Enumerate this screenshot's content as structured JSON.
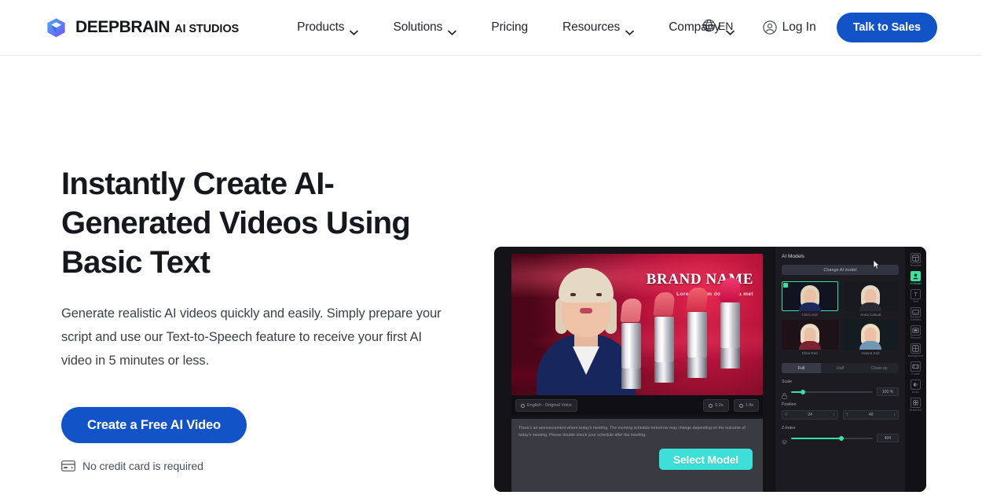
{
  "brand": {
    "name": "DEEPBRAIN",
    "subtitle": "AI STUDIOS",
    "logo_icon": "cube-logo-icon",
    "gradient_start": "#4ea8ff",
    "gradient_end": "#7a4df0"
  },
  "nav": {
    "items": [
      {
        "label": "Products",
        "has_dropdown": true,
        "icon": "chevron-down-icon"
      },
      {
        "label": "Solutions",
        "has_dropdown": true,
        "icon": "chevron-down-icon"
      },
      {
        "label": "Pricing",
        "has_dropdown": false,
        "icon": ""
      },
      {
        "label": "Resources",
        "has_dropdown": true,
        "icon": "chevron-down-icon"
      },
      {
        "label": "Company",
        "has_dropdown": true,
        "icon": "chevron-down-icon"
      }
    ]
  },
  "language": {
    "code": "EN",
    "icon": "globe-icon"
  },
  "account": {
    "login_label": "Log In",
    "login_icon": "user-circle-icon",
    "cta_label": "Talk to Sales",
    "cta_color": "#1254c8"
  },
  "hero": {
    "title": "Instantly Create AI-Generated Videos Using Basic Text",
    "subtitle": "Generate realistic AI videos quickly and easily. Simply prepare your script and use our Text-to-Speech feature to receive your first AI video in 5 minutes or less.",
    "cta_label": "Create a Free AI Video",
    "cta_color": "#1254c8",
    "note": "No credit card is required",
    "note_icon": "credit-card-icon"
  },
  "preview": {
    "stage": {
      "brand_name": "BRAND NAME",
      "brand_tagline": "Lorem ipsum dolor sit a met"
    },
    "player_bar": {
      "voice_label": "English - Original Voice",
      "voice_icon": "waveform-icon",
      "duration_label": "0.2s",
      "duration_icon": "clock-icon",
      "total_label": "1.4s",
      "total_icon": "clock-icon"
    },
    "script": "There's an announcement where today's meeting. The morning schedule tomorrow may change depending on the outcome of today's meeting. Please double-check your schedule after the meeting.",
    "select_model_label": "Select Model",
    "select_model_color": "#3ce0d8",
    "panel": {
      "title": "AI Models",
      "change_model_label": "Change AI model",
      "models": [
        {
          "label": "Clara Suit",
          "selected": true,
          "hair": "#ded3bc",
          "shoulder": "#1b2a5e"
        },
        {
          "label": "Anna Casual",
          "selected": false,
          "hair": "#e3d9c6",
          "shoulder": "#2a2a34"
        },
        {
          "label": "Elina Red",
          "selected": false,
          "hair": "#e8dcc5",
          "shoulder": "#7d2230"
        },
        {
          "label": "Hanna Knit",
          "selected": false,
          "hair": "#e9dcc0",
          "shoulder": "#6f97b5"
        }
      ],
      "size_tabs": [
        {
          "label": "Full",
          "active": true
        },
        {
          "label": "Half",
          "active": false
        },
        {
          "label": "Close-up",
          "active": false
        }
      ],
      "scale": {
        "label": "Scale",
        "value": "100 %",
        "percent": 14,
        "lock_icon": "link-icon"
      },
      "position": {
        "label": "Position",
        "x_axis": "X",
        "x_value": "24",
        "y_axis": "Y",
        "y_value": "40"
      },
      "zindex": {
        "label": "Z-Index",
        "value": "404",
        "percent": 62,
        "lock_icon": "layers-icon"
      }
    },
    "rail": [
      {
        "label": "Template",
        "icon": "template-icon",
        "active": false
      },
      {
        "label": "AI Model",
        "icon": "ai-model-icon",
        "active": true
      },
      {
        "label": "Text",
        "icon": "text-icon",
        "active": false
      },
      {
        "label": "Subtitles",
        "icon": "subtitles-icon",
        "active": false
      },
      {
        "label": "Element",
        "icon": "element-icon",
        "active": false
      },
      {
        "label": "Background",
        "icon": "background-icon",
        "active": false
      },
      {
        "label": "Frame",
        "icon": "frame-icon",
        "active": false
      },
      {
        "label": "Audio",
        "icon": "audio-icon",
        "active": false
      },
      {
        "label": "Brand Kit",
        "icon": "brandkit-icon",
        "active": false
      }
    ],
    "cursor_icon": "mouse-pointer-icon"
  }
}
